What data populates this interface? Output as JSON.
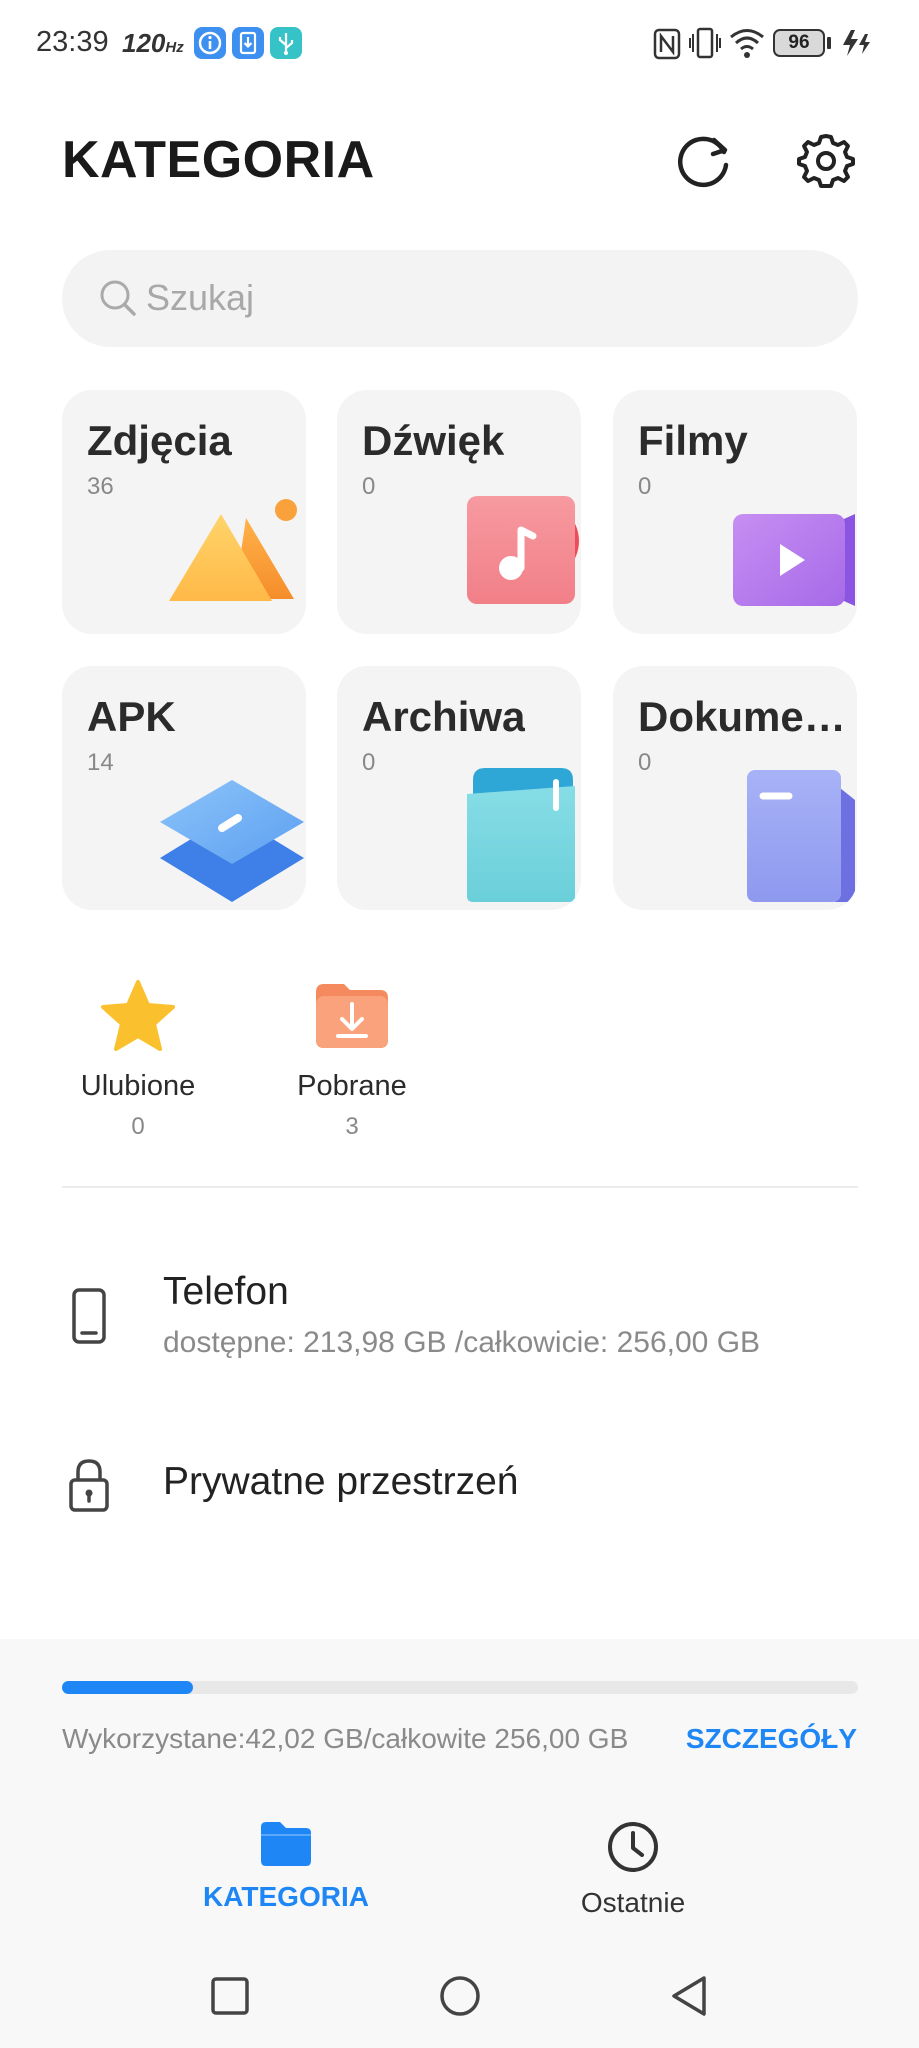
{
  "status_bar": {
    "time": "23:39",
    "refresh_rate": "120",
    "refresh_unit": "Hz",
    "battery": "96"
  },
  "header": {
    "title": "KATEGORIA",
    "refresh_icon": "refresh-icon",
    "settings_icon": "gear-icon"
  },
  "search": {
    "placeholder": "Szukaj"
  },
  "categories": [
    {
      "label": "Zdjęcia",
      "count": "36",
      "icon": "photos-icon"
    },
    {
      "label": "Dźwięk",
      "count": "0",
      "icon": "music-icon"
    },
    {
      "label": "Filmy",
      "count": "0",
      "icon": "video-icon"
    },
    {
      "label": "APK",
      "count": "14",
      "icon": "apk-icon"
    },
    {
      "label": "Archiwa",
      "count": "0",
      "icon": "archive-icon"
    },
    {
      "label": "Dokume…",
      "count": "0",
      "icon": "document-icon"
    }
  ],
  "quick": [
    {
      "label": "Ulubione",
      "count": "0",
      "icon": "star-icon"
    },
    {
      "label": "Pobrane",
      "count": "3",
      "icon": "download-folder-icon"
    }
  ],
  "storage": {
    "phone_name": "Telefon",
    "phone_info": "dostępne: 213,98 GB /całkowicie: 256,00 GB",
    "private_name": "Prywatne przestrzeń"
  },
  "usage": {
    "text": "Wykorzystane:42,02 GB/całkowite 256,00 GB",
    "details_label": "SZCZEGÓŁY",
    "used_fraction": 0.164
  },
  "nav": {
    "tab_category": "KATEGORIA",
    "tab_recent": "Ostatnie"
  },
  "colors": {
    "accent": "#1f87f5"
  }
}
